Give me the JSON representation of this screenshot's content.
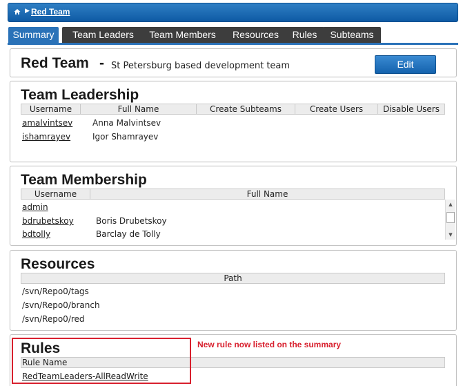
{
  "breadcrumb": {
    "current": "Red Team",
    "home_icon": "home-icon"
  },
  "tabs": [
    {
      "label": "Summary",
      "active": true
    },
    {
      "label": "Team Leaders",
      "active": false
    },
    {
      "label": "Team Members",
      "active": false
    },
    {
      "label": "Resources",
      "active": false
    },
    {
      "label": "Rules",
      "active": false
    },
    {
      "label": "Subteams",
      "active": false
    }
  ],
  "header": {
    "team_name": "Red Team",
    "separator": "-",
    "description": "St Petersburg based development team",
    "edit_label": "Edit"
  },
  "leadership": {
    "title": "Team Leadership",
    "columns": [
      "Username",
      "Full Name",
      "Create Subteams",
      "Create Users",
      "Disable Users"
    ],
    "rows": [
      {
        "username": "amalvintsev",
        "full_name": "Anna Malvintsev"
      },
      {
        "username": "ishamrayev",
        "full_name": "Igor Shamrayev"
      }
    ]
  },
  "membership": {
    "title": "Team Membership",
    "columns": [
      "Username",
      "Full Name"
    ],
    "rows": [
      {
        "username": "admin",
        "full_name": ""
      },
      {
        "username": "bdrubetskoy",
        "full_name": "Boris Drubetskoy"
      },
      {
        "username": "bdtolly",
        "full_name": "Barclay de Tolly"
      }
    ]
  },
  "resources": {
    "title": "Resources",
    "columns": [
      "Path"
    ],
    "rows": [
      "/svn/Repo0/tags",
      "/svn/Repo0/branch",
      "/svn/Repo0/red"
    ]
  },
  "rules": {
    "title": "Rules",
    "columns": [
      "Rule Name"
    ],
    "rows": [
      "RedTeamLeaders-AllReadWrite"
    ]
  },
  "annotation": "New rule now listed on the summary",
  "colors": {
    "accent": "#2a72b8",
    "tab_inactive": "#3d3d3d",
    "highlight": "#d8202e"
  }
}
